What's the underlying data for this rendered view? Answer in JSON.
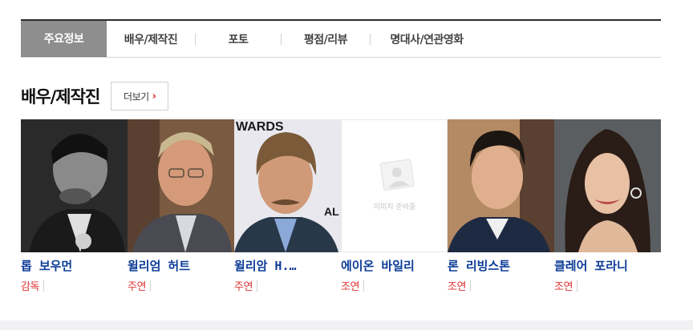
{
  "tabs": [
    {
      "label": "주요정보",
      "active": true
    },
    {
      "label": "배우/제작진",
      "active": false
    },
    {
      "label": "포토",
      "active": false
    },
    {
      "label": "평점/리뷰",
      "active": false
    },
    {
      "label": "명대사/연관영화",
      "active": false
    }
  ],
  "section": {
    "title": "배우/제작진",
    "more_label": "더보기",
    "more_icon": "chevron-right-icon",
    "accent_color": "#e02020"
  },
  "cast": [
    {
      "name": "롭 보우먼",
      "role": "감독"
    },
    {
      "name": "윌리엄 허트",
      "role": "주연"
    },
    {
      "name": "윌리암 H.…",
      "role": "주연"
    },
    {
      "name": "에이온 바일리",
      "role": "조연",
      "placeholder_text": "이미지 준비중"
    },
    {
      "name": "론 리빙스톤",
      "role": "조연"
    },
    {
      "name": "클레어 포라니",
      "role": "조연"
    }
  ],
  "colors": {
    "name_link": "#0c3c96",
    "role_text": "#dd3333",
    "active_tab_bg": "#8e8e8e"
  }
}
